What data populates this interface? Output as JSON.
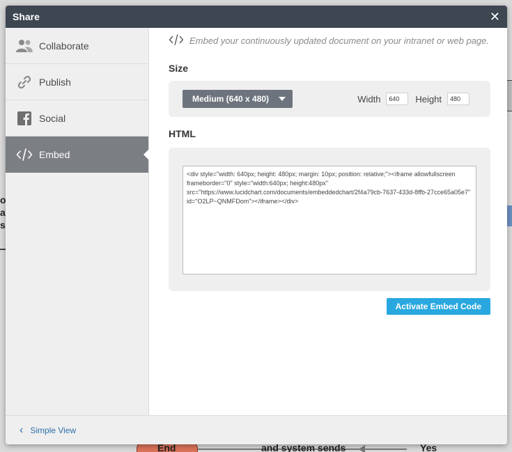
{
  "background": {
    "left_text": [
      "or",
      "at",
      "s"
    ],
    "end_label": "End",
    "middle_label": "and system sends",
    "yes_label": "Yes"
  },
  "modal": {
    "title": "Share",
    "close_icon": "close-icon"
  },
  "sidebar": {
    "items": [
      {
        "label": "Collaborate",
        "icon": "people-icon",
        "active": false
      },
      {
        "label": "Publish",
        "icon": "link-icon",
        "active": false
      },
      {
        "label": "Social",
        "icon": "facebook-icon",
        "active": false
      },
      {
        "label": "Embed",
        "icon": "code-icon",
        "active": true
      }
    ]
  },
  "embed": {
    "description": "Embed your continuously updated document on your intranet or web page.",
    "size_title": "Size",
    "size_selected": "Medium (640 x 480)",
    "width_label": "Width",
    "width_value": "640",
    "height_label": "Height",
    "height_value": "480",
    "html_title": "HTML",
    "html_code": "<div style=\"width: 640px; height: 480px; margin: 10px; position: relative;\"><iframe allowfullscreen frameborder=\"0\" style=\"width:640px; height:480px\" src=\"https://www.lucidchart.com/documents/embeddedchart/2f4a79cb-7637-433d-8ffb-27cce65a05e7\" id=\"O2LP~QNMFDom\"></iframe></div>",
    "activate_label": "Activate Embed Code"
  },
  "footer": {
    "simple_view_label": "Simple View"
  },
  "colors": {
    "header_bg": "#3d4651",
    "active_item_bg": "#7b7e82",
    "button_blue": "#29a8e0",
    "link_blue": "#2e6fa8"
  }
}
